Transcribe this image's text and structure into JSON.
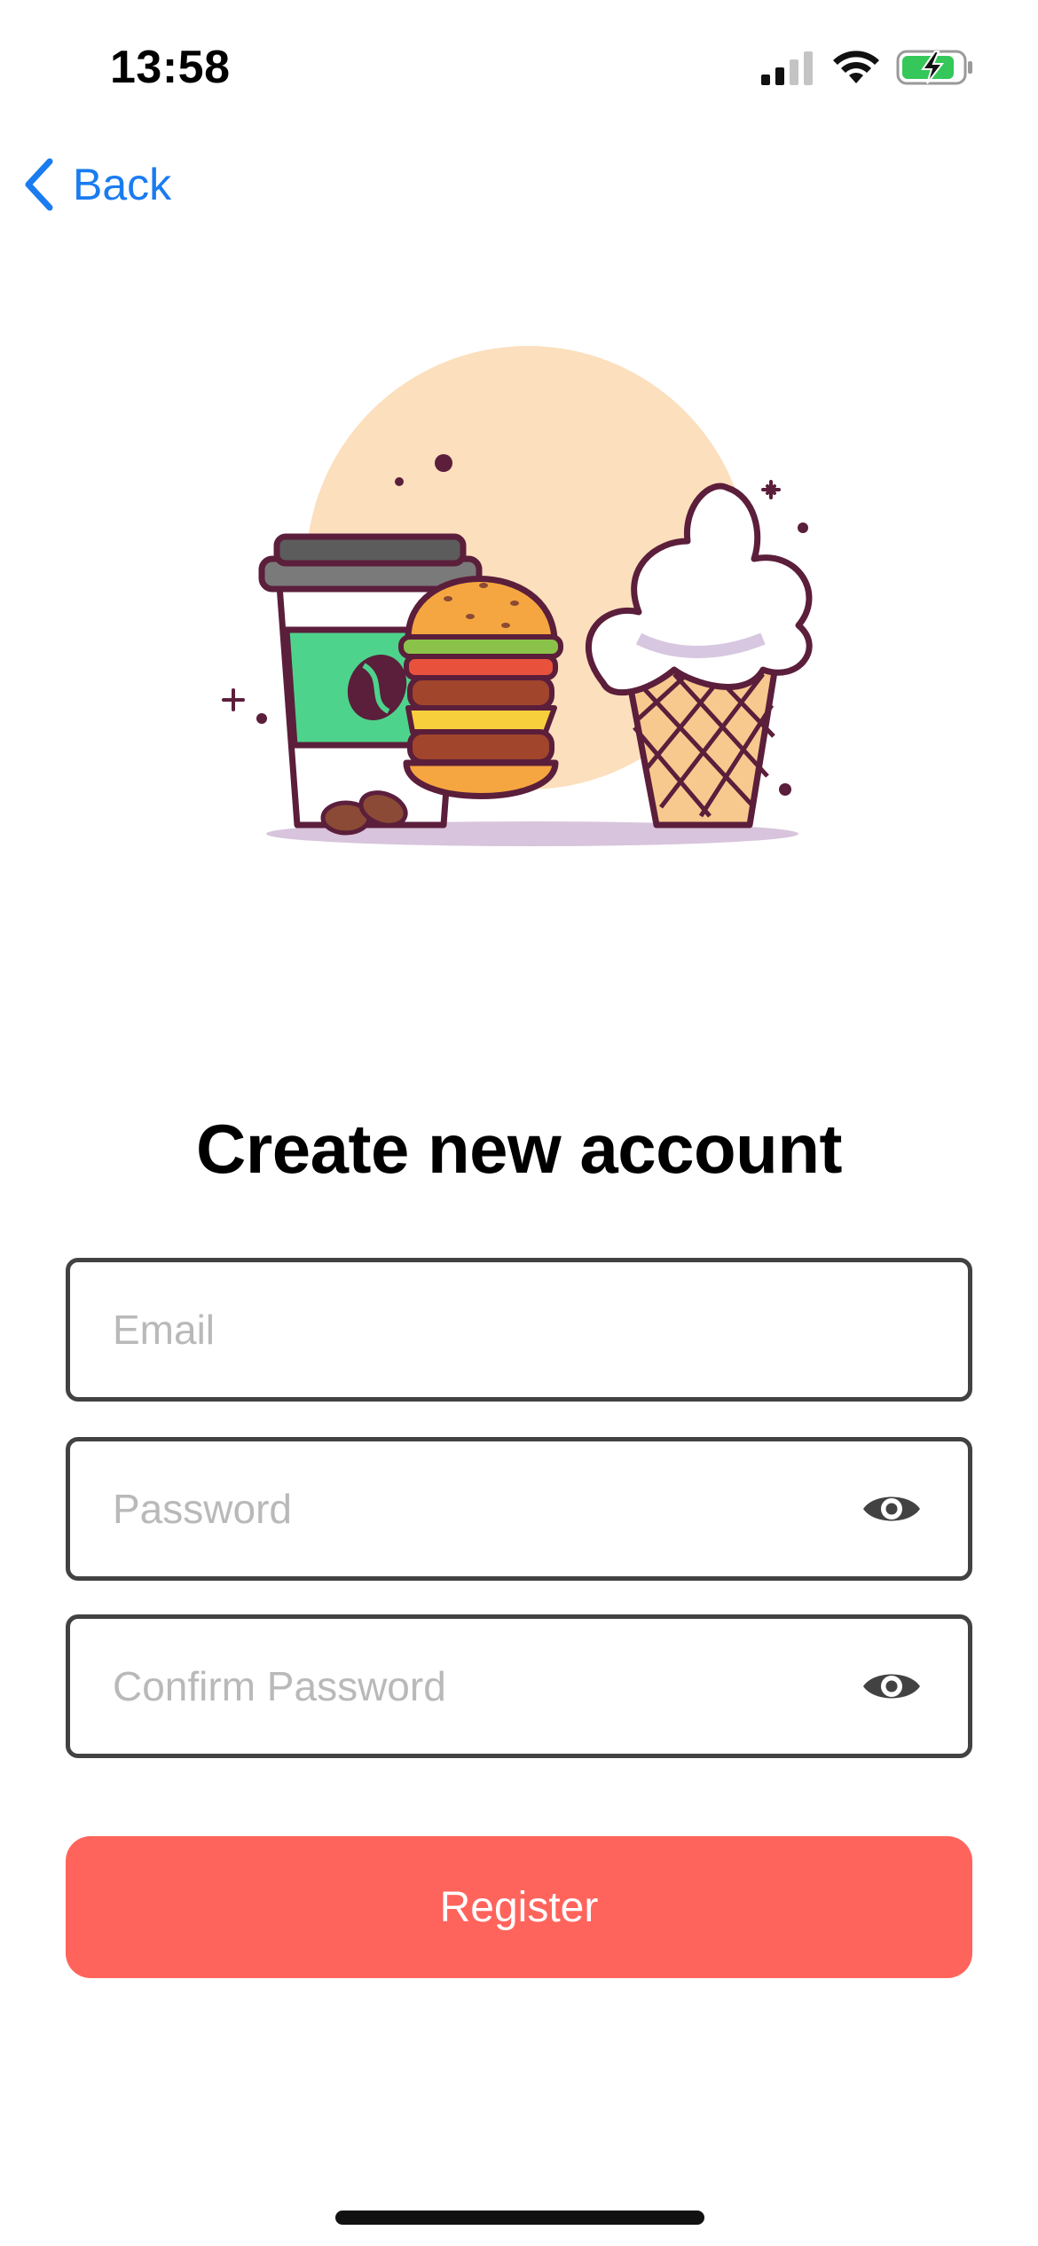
{
  "status_bar": {
    "time": "13:58",
    "icons": [
      "cellular-signal-icon",
      "wifi-icon",
      "battery-charging-icon"
    ]
  },
  "nav": {
    "back_label": "Back"
  },
  "hero": {
    "illustration": "coffee-burger-icecream-illustration"
  },
  "title": "Create new account",
  "form": {
    "email": {
      "placeholder": "Email",
      "value": ""
    },
    "password": {
      "placeholder": "Password",
      "value": ""
    },
    "confirm_password": {
      "placeholder": "Confirm Password",
      "value": ""
    }
  },
  "register_button": {
    "label": "Register"
  },
  "colors": {
    "accent_blue": "#1a7cf0",
    "register_red": "#ff645c",
    "field_border": "#424242",
    "placeholder": "#b9b9b9"
  }
}
